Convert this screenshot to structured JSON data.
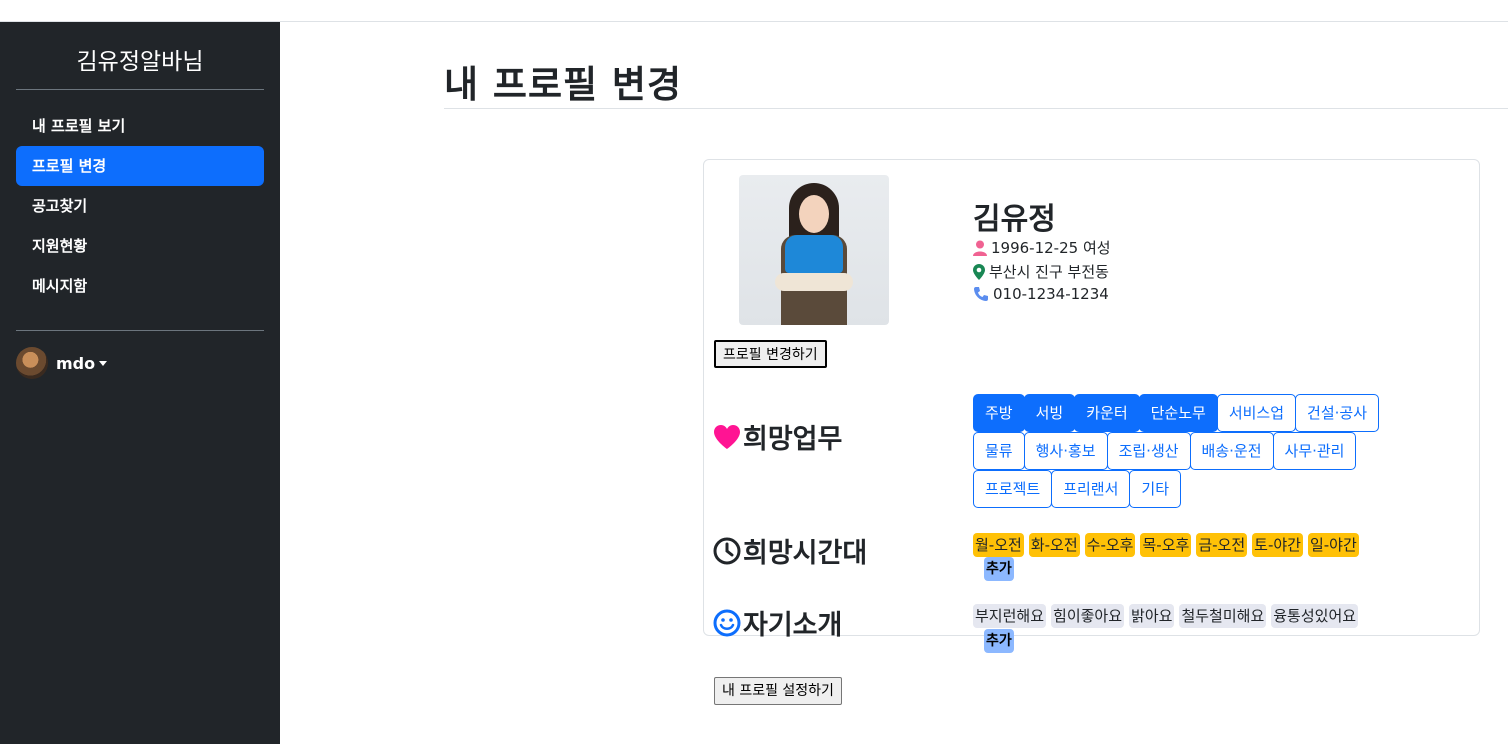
{
  "sidebar": {
    "brand": "김유정알바님",
    "items": [
      {
        "label": "내 프로필 보기",
        "active": false
      },
      {
        "label": "프로필 변경",
        "active": true
      },
      {
        "label": "공고찾기",
        "active": false
      },
      {
        "label": "지원현황",
        "active": false
      },
      {
        "label": "메시지함",
        "active": false
      }
    ],
    "user": "mdo"
  },
  "page": {
    "title": "내 프로필 변경"
  },
  "profile": {
    "name": "김유정",
    "birth_gender": "1996-12-25 여성",
    "address": "부산시 진구 부전동",
    "phone": "010-1234-1234",
    "change_button": "프로필 변경하기"
  },
  "jobs": {
    "label": "희망업무",
    "tags": [
      {
        "label": "주방",
        "selected": true
      },
      {
        "label": "서빙",
        "selected": true
      },
      {
        "label": "카운터",
        "selected": true
      },
      {
        "label": "단순노무",
        "selected": true
      },
      {
        "label": "서비스업",
        "selected": false
      },
      {
        "label": "건설·공사",
        "selected": false
      },
      {
        "label": "물류",
        "selected": false
      },
      {
        "label": "행사·홍보",
        "selected": false
      },
      {
        "label": "조립·생산",
        "selected": false
      },
      {
        "label": "배송·운전",
        "selected": false
      },
      {
        "label": "사무·관리",
        "selected": false
      },
      {
        "label": "프로젝트",
        "selected": false
      },
      {
        "label": "프리랜서",
        "selected": false
      },
      {
        "label": "기타",
        "selected": false
      }
    ]
  },
  "times": {
    "label": "희망시간대",
    "chips": [
      "월-오전",
      "화-오전",
      "수-오후",
      "목-오후",
      "금-오전",
      "토-야간",
      "일-야간"
    ],
    "add_label": "추가"
  },
  "intro": {
    "label": "자기소개",
    "chips": [
      "부지런해요",
      "힘이좋아요",
      "밝아요",
      "철두철미해요",
      "융통성있어요"
    ],
    "add_label": "추가"
  },
  "submit_button": "내 프로필 설정하기",
  "colors": {
    "sidebar_bg": "#212529",
    "primary": "#0d6efd",
    "time_chip": "#ffc107",
    "heart": "#ff1493",
    "person_icon": "#f06292",
    "location_icon": "#198754",
    "phone_icon": "#5b8def"
  }
}
